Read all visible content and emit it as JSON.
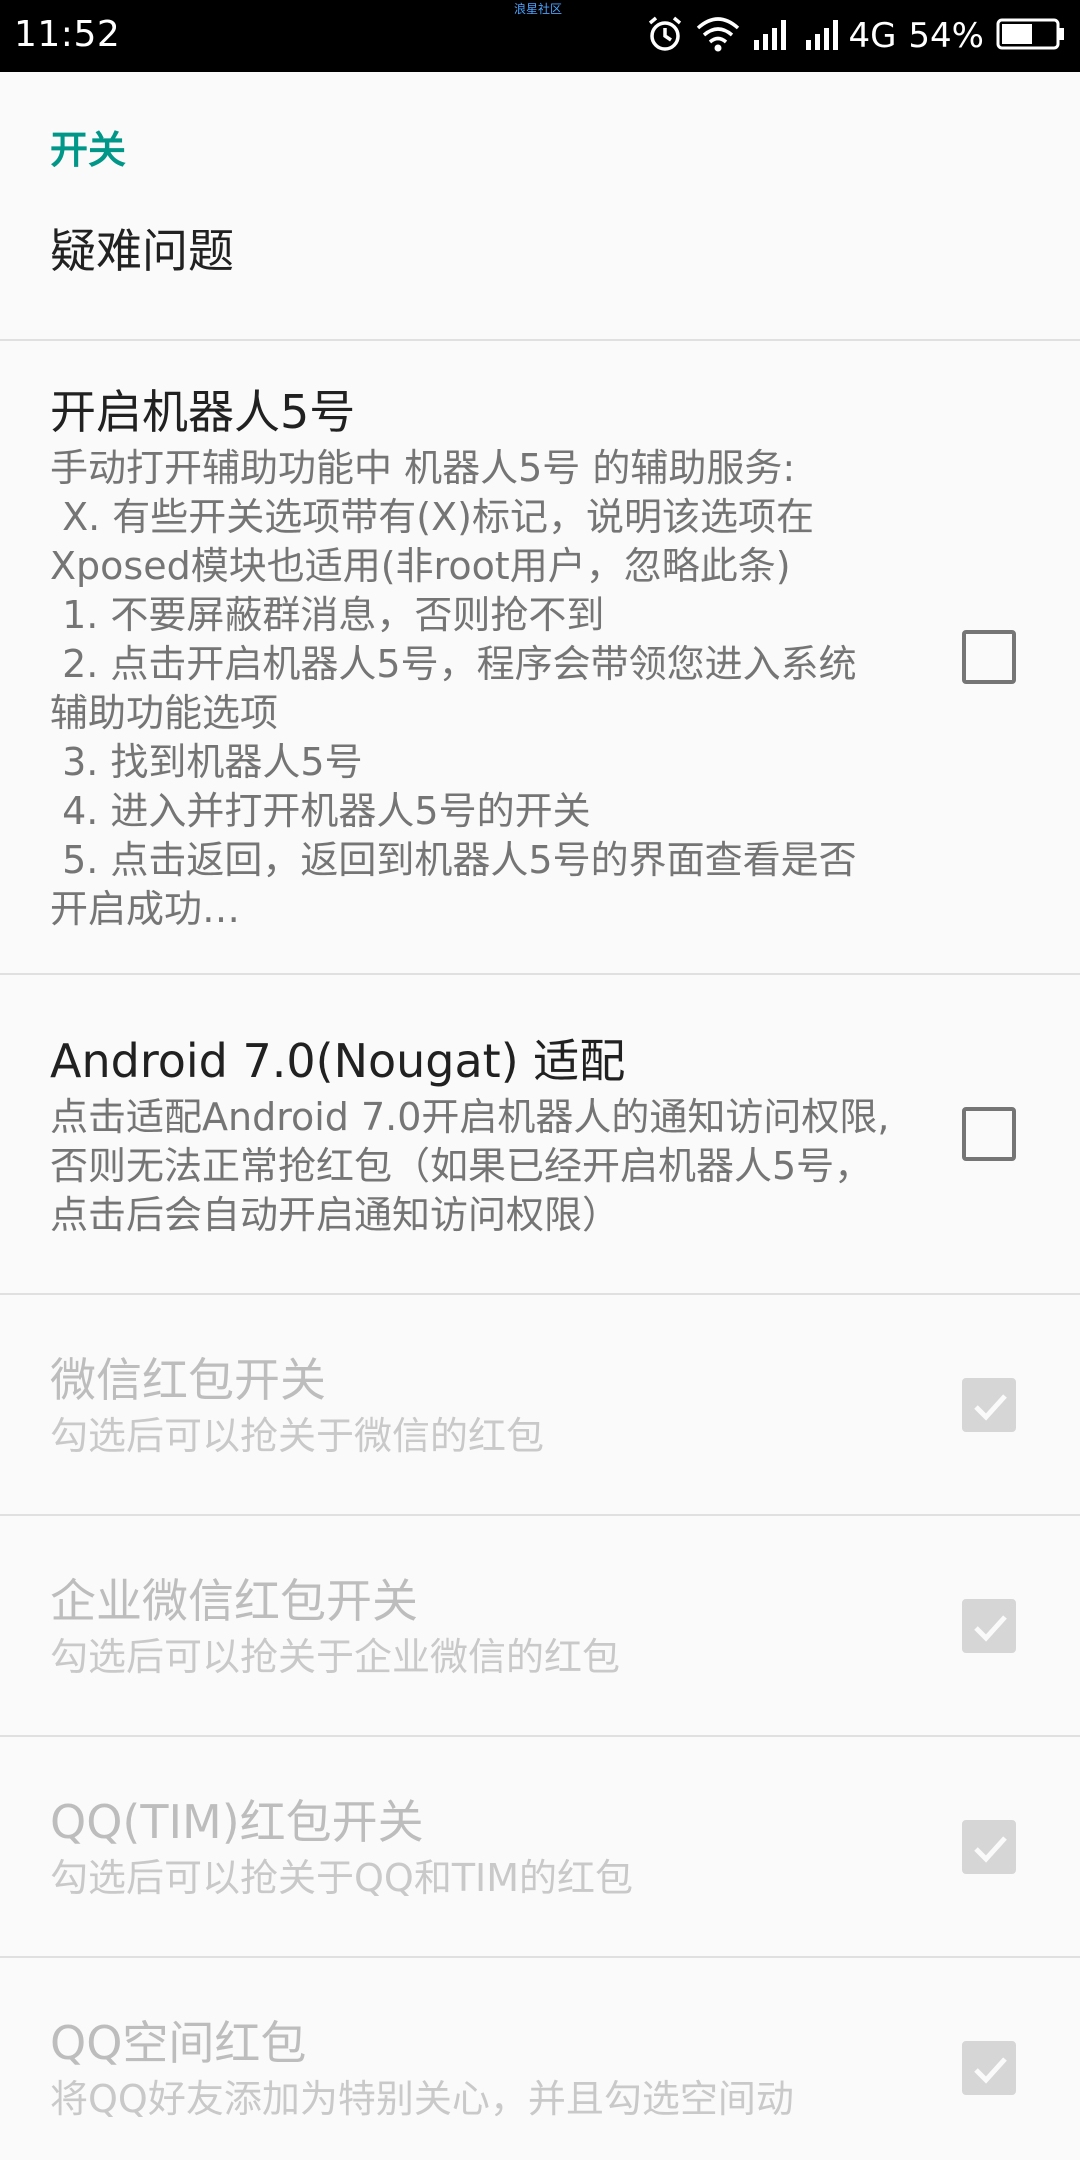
{
  "status_bar": {
    "time": "11:52",
    "carrier_label": "浪星社区",
    "network": "4G",
    "battery": "54%"
  },
  "category": {
    "title": "开关"
  },
  "troubleshoot": {
    "title": "疑难问题"
  },
  "preferences": [
    {
      "title": "开启机器人5号",
      "summary": "手动打开辅助功能中 机器人5号 的辅助服务:\n X. 有些开关选项带有(X)标记，说明该选项在Xposed模块也适用(非root用户，忽略此条)\n 1. 不要屏蔽群消息，否则抢不到\n 2. 点击开启机器人5号，程序会带领您进入系统辅助功能选项\n 3. 找到机器人5号\n 4. 进入并打开机器人5号的开关\n 5. 点击返回，返回到机器人5号的界面查看是否开启成功…",
      "checked": false,
      "enabled": true
    },
    {
      "title": "Android 7.0(Nougat) 适配",
      "summary": "点击适配Android 7.0开启机器人的通知访问权限,否则无法正常抢红包（如果已经开启机器人5号，点击后会自动开启通知访问权限）",
      "checked": false,
      "enabled": true
    },
    {
      "title": "微信红包开关",
      "summary": "勾选后可以抢关于微信的红包",
      "checked": true,
      "enabled": false
    },
    {
      "title": "企业微信红包开关",
      "summary": "勾选后可以抢关于企业微信的红包",
      "checked": true,
      "enabled": false
    },
    {
      "title": "QQ(TIM)红包开关",
      "summary": "勾选后可以抢关于QQ和TIM的红包",
      "checked": true,
      "enabled": false
    },
    {
      "title": "QQ空间红包",
      "summary": "将QQ好友添加为特别关心，并且勾选空间动",
      "checked": true,
      "enabled": false
    }
  ],
  "colors": {
    "accent": "#009688",
    "divider": "#e0e0e0",
    "checkbox_checked_disabled": "#d6d6d6"
  }
}
